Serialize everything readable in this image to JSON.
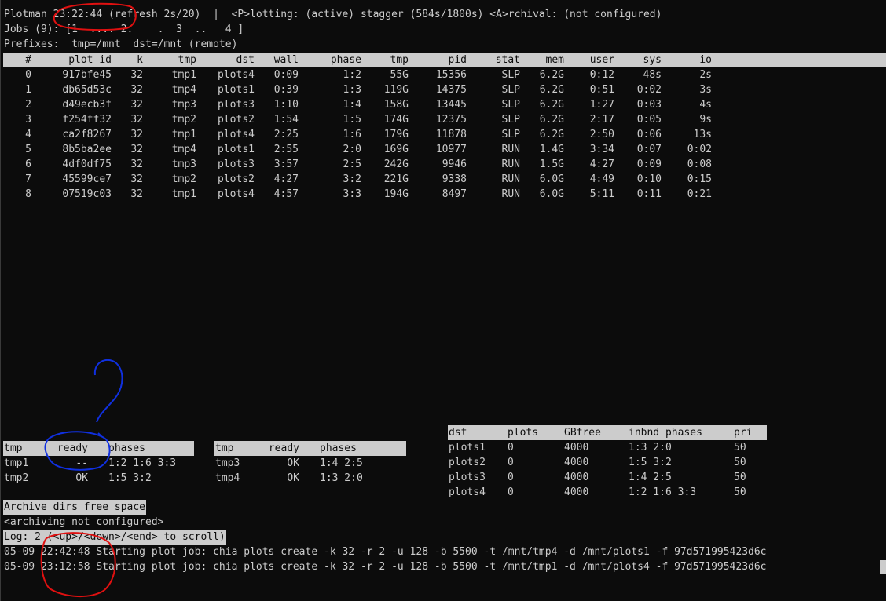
{
  "header": {
    "line1": "Plotman 23:22:44 (refresh 2s/20)  |  <P>lotting: (active) stagger (584s/1800s) <A>rchival: (not configured)",
    "line2": "Jobs (9): [1  .... 2.    .  3  ..   4 ]",
    "line3": "Prefixes:  tmp=/mnt  dst=/mnt (remote)"
  },
  "jobs": {
    "columns": [
      "#",
      "plot id",
      "k",
      "tmp",
      "dst",
      "wall",
      "phase",
      "tmp",
      "pid",
      "stat",
      "mem",
      "user",
      "sys",
      "io"
    ],
    "rows": [
      [
        "0",
        "917bfe45",
        "32",
        "tmp1",
        "plots4",
        "0:09",
        "1:2",
        "55G",
        "15356",
        "SLP",
        "6.2G",
        "0:12",
        "48s",
        "2s"
      ],
      [
        "1",
        "db65d53c",
        "32",
        "tmp4",
        "plots1",
        "0:39",
        "1:3",
        "119G",
        "14375",
        "SLP",
        "6.2G",
        "0:51",
        "0:02",
        "3s"
      ],
      [
        "2",
        "d49ecb3f",
        "32",
        "tmp3",
        "plots3",
        "1:10",
        "1:4",
        "158G",
        "13445",
        "SLP",
        "6.2G",
        "1:27",
        "0:03",
        "4s"
      ],
      [
        "3",
        "f254ff32",
        "32",
        "tmp2",
        "plots2",
        "1:54",
        "1:5",
        "174G",
        "12375",
        "SLP",
        "6.2G",
        "2:17",
        "0:05",
        "9s"
      ],
      [
        "4",
        "ca2f8267",
        "32",
        "tmp1",
        "plots4",
        "2:25",
        "1:6",
        "179G",
        "11878",
        "SLP",
        "6.2G",
        "2:50",
        "0:06",
        "13s"
      ],
      [
        "5",
        "8b5ba2ee",
        "32",
        "tmp4",
        "plots1",
        "2:55",
        "2:0",
        "169G",
        "10977",
        "RUN",
        "1.4G",
        "3:34",
        "0:07",
        "0:02"
      ],
      [
        "6",
        "4df0df75",
        "32",
        "tmp3",
        "plots3",
        "3:57",
        "2:5",
        "242G",
        "9946",
        "RUN",
        "1.5G",
        "4:27",
        "0:09",
        "0:08"
      ],
      [
        "7",
        "45599ce7",
        "32",
        "tmp2",
        "plots2",
        "4:27",
        "3:2",
        "221G",
        "9338",
        "RUN",
        "6.0G",
        "4:49",
        "0:10",
        "0:15"
      ],
      [
        "8",
        "07519c03",
        "32",
        "tmp1",
        "plots4",
        "4:57",
        "3:3",
        "194G",
        "8497",
        "RUN",
        "6.0G",
        "5:11",
        "0:11",
        "0:21"
      ]
    ]
  },
  "tmp_tables": [
    {
      "columns": [
        "tmp",
        "ready",
        "phases"
      ],
      "rows": [
        [
          "tmp1",
          "--",
          "1:2 1:6 3:3"
        ],
        [
          "tmp2",
          "OK",
          "1:5 3:2"
        ]
      ]
    },
    {
      "columns": [
        "tmp",
        "ready",
        "phases"
      ],
      "rows": [
        [
          "tmp3",
          "OK",
          "1:4 2:5"
        ],
        [
          "tmp4",
          "OK",
          "1:3 2:0"
        ]
      ]
    }
  ],
  "dst_table": {
    "columns": [
      "dst",
      "plots",
      "GBfree",
      "inbnd phases",
      "pri"
    ],
    "rows": [
      [
        "plots1",
        "0",
        "4000",
        "1:3 2:0",
        "50"
      ],
      [
        "plots2",
        "0",
        "4000",
        "1:5 3:2",
        "50"
      ],
      [
        "plots3",
        "0",
        "4000",
        "1:4 2:5",
        "50"
      ],
      [
        "plots4",
        "0",
        "4000",
        "1:2 1:6 3:3",
        "50"
      ]
    ]
  },
  "archive": {
    "title": "Archive dirs free space",
    "status": "<archiving not configured>"
  },
  "log": {
    "title": "Log: 2 (<up>/<down>/<end> to scroll)",
    "lines": [
      "05-09 22:42:48 Starting plot job: chia plots create -k 32 -r 2 -u 128 -b 5500 -t /mnt/tmp4 -d /mnt/plots1 -f 97d571995423d6c",
      "05-09 23:12:58 Starting plot job: chia plots create -k 32 -r 2 -u 128 -b 5500 -t /mnt/tmp1 -d /mnt/plots4 -f 97d571995423d6c"
    ]
  },
  "annotation_colors": {
    "red": "#e01010",
    "blue": "#1030e0"
  }
}
